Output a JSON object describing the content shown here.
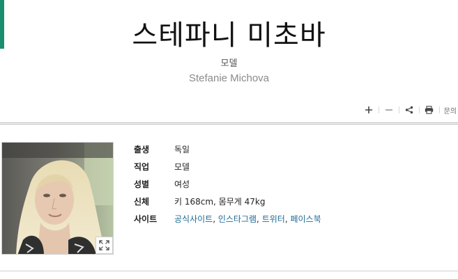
{
  "header": {
    "title": "스테파니 미초바",
    "subtitle": "모델",
    "name_en": "Stefanie Michova"
  },
  "toolbar": {
    "items": [
      "plus-icon",
      "minus-icon",
      "share-icon",
      "print-icon"
    ],
    "inquiry_label": "문의"
  },
  "profile": {
    "rows": [
      {
        "label": "출생",
        "value": "독일"
      },
      {
        "label": "직업",
        "value": "모델"
      },
      {
        "label": "성별",
        "value": "여성"
      },
      {
        "label": "신체",
        "value": "키 168cm, 몸무게 47kg"
      }
    ],
    "site_label": "사이트",
    "sites": [
      "공식사이트",
      "인스타그램",
      "트위터",
      "페이스북"
    ]
  },
  "colors": {
    "accent": "#1a8f6e",
    "link": "#1d6a96"
  }
}
